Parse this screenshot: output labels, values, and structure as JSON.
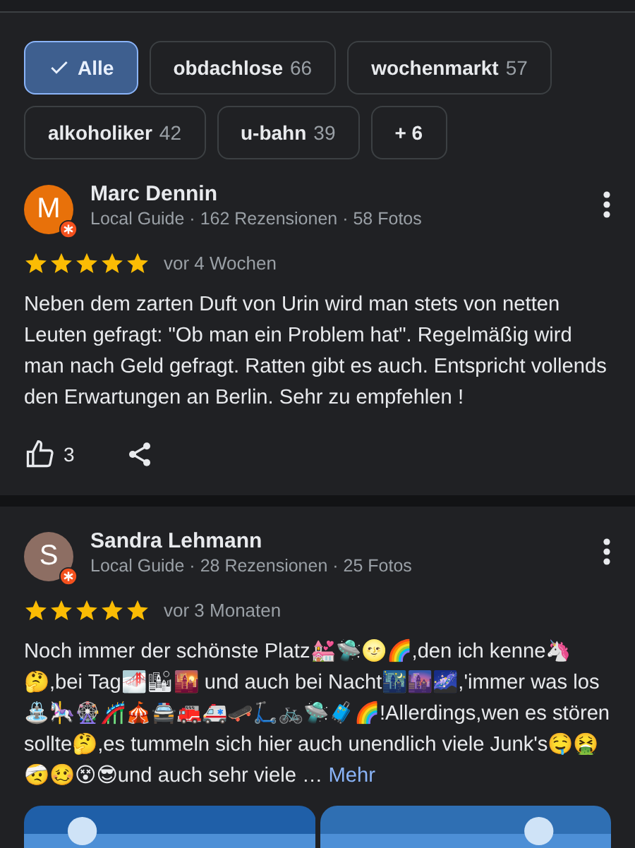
{
  "filters": [
    {
      "label": "Alle",
      "selected": true
    },
    {
      "label": "obdachlose",
      "count": "66",
      "selected": false
    },
    {
      "label": "wochenmarkt",
      "count": "57",
      "selected": false
    },
    {
      "label": "alkoholiker",
      "count": "42",
      "selected": false
    },
    {
      "label": "u-bahn",
      "count": "39",
      "selected": false
    },
    {
      "label": "+ 6",
      "selected": false
    }
  ],
  "reviews": [
    {
      "initial": "M",
      "color": "#e8710a",
      "name": "Marc Dennin",
      "meta": "Local Guide · 162 Rezensionen · 58 Fotos",
      "stars": 5,
      "time": "vor 4 Wochen",
      "text": "Neben dem zarten Duft von Urin wird man stets von netten Leuten gefragt: \"Ob man ein Problem hat\". Regelmäßig wird man nach Geld gefragt. Ratten gibt es auch. Entspricht vollends den Erwartungen an Berlin. Sehr zu empfehlen !",
      "likes": "3"
    },
    {
      "initial": "S",
      "color": "#8d6e63",
      "name": "Sandra Lehmann",
      "meta": "Local Guide · 28 Rezensionen · 25 Fotos",
      "stars": 5,
      "time": "vor 3 Monaten",
      "text": "Noch immer der schönste Platz💒🛸🌝🌈,den ich kenne🦄🤔,bei Tag🌁🏙🌇 und auch bei Nacht🌃🌆🌌,'immer was los⛲🎠🎡🎢🎪🚔🚒🚑🛹🛴🚲🛸🧳🌈!Allerdings,wen es stören sollte🤔,es tummeln sich hier auch unendlich viele Junk's🤤🤮🤕🥴😵😎und auch sehr viele …",
      "more": "Mehr",
      "photos": [
        {
          "kind": "picture"
        },
        {
          "kind": "picture"
        }
      ]
    }
  ]
}
